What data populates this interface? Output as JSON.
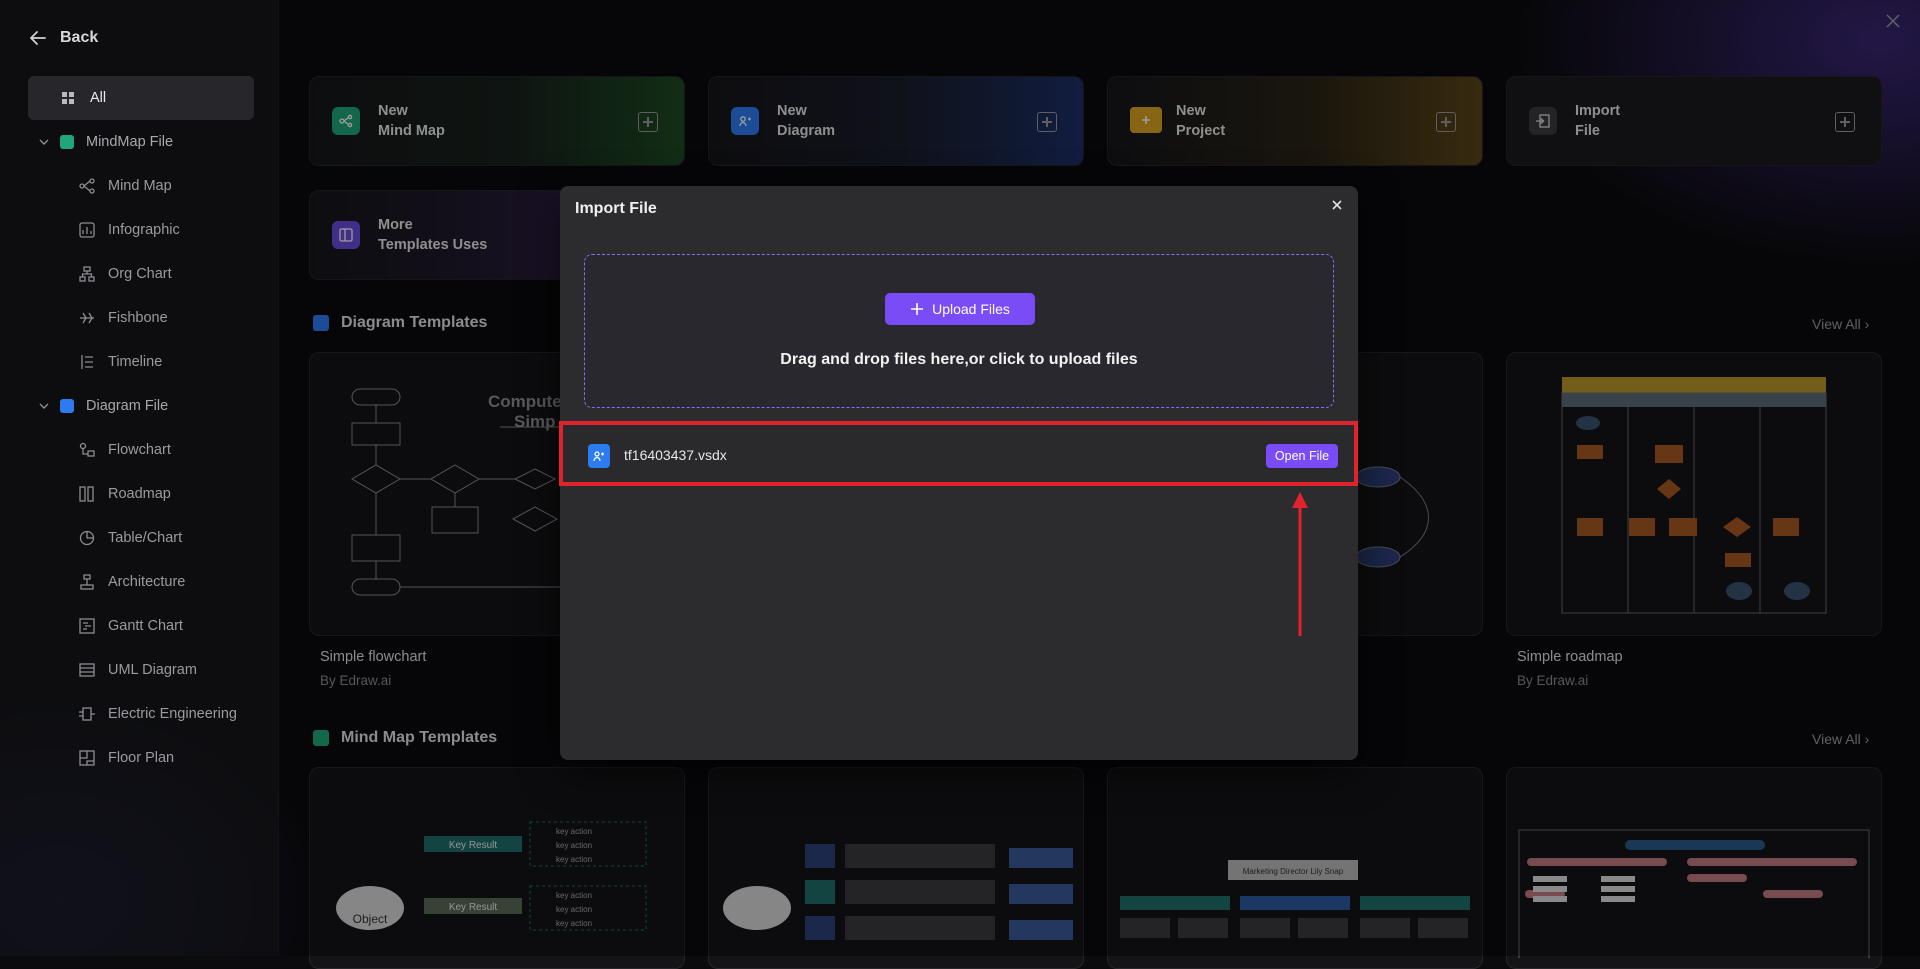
{
  "sidebar": {
    "back_label": "Back",
    "all_label": "All",
    "groups": [
      {
        "label": "MindMap File",
        "color": "#1fa67a",
        "items": [
          {
            "label": "Mind Map",
            "icon": "mindmap-icon"
          },
          {
            "label": "Infographic",
            "icon": "infographic-icon"
          },
          {
            "label": "Org Chart",
            "icon": "orgchart-icon"
          },
          {
            "label": "Fishbone",
            "icon": "fishbone-icon"
          },
          {
            "label": "Timeline",
            "icon": "timeline-icon"
          }
        ]
      },
      {
        "label": "Diagram File",
        "color": "#2d7bf0",
        "items": [
          {
            "label": "Flowchart",
            "icon": "flowchart-icon"
          },
          {
            "label": "Roadmap",
            "icon": "roadmap-icon"
          },
          {
            "label": "Table/Chart",
            "icon": "table-chart-icon"
          },
          {
            "label": "Architecture",
            "icon": "architecture-icon"
          },
          {
            "label": "Gantt Chart",
            "icon": "gantt-icon"
          },
          {
            "label": "UML Diagram",
            "icon": "uml-icon"
          },
          {
            "label": "Electric Engineering",
            "icon": "electric-icon"
          },
          {
            "label": "Floor Plan",
            "icon": "floorplan-icon"
          }
        ]
      }
    ]
  },
  "cards": {
    "mindmap": {
      "line1": "New",
      "line2": "Mind Map",
      "color": "#1fa67a"
    },
    "diagram": {
      "line1": "New",
      "line2": "Diagram",
      "color": "#2d7bf0"
    },
    "project": {
      "line1": "New",
      "line2": "Project",
      "color": "#d9a521"
    },
    "import": {
      "line1": "Import",
      "line2": "File",
      "color": "#4a4a50"
    },
    "templates": {
      "line1": "More",
      "line2": "Templates Uses",
      "color": "#6a4bd8"
    }
  },
  "sections": {
    "diagram_templates": "Diagram Templates",
    "mindmap_templates": "Mind Map Templates",
    "view_all": "View All"
  },
  "templates": [
    {
      "name": "Simple flowchart",
      "by": "By Edraw.ai"
    },
    {
      "name": "Simple roadmap",
      "by": "By Edraw.ai"
    }
  ],
  "flowchart_preview": {
    "title_line1": "Compute",
    "title_line2": "Simp"
  },
  "mindmap_preview": {
    "object": "Object",
    "key_result": "Key Result",
    "key_action": "key action"
  },
  "orgchart_preview": {
    "title": "Marketing Director Lily Snap"
  },
  "modal": {
    "title": "Import File",
    "upload_label": "Upload Files",
    "drop_text": "Drag and drop files here,or click to upload files",
    "file_name": "tf16403437.vsdx",
    "open_label": "Open File",
    "accent": "#7a4cf5",
    "highlight_color": "#e0232c"
  }
}
